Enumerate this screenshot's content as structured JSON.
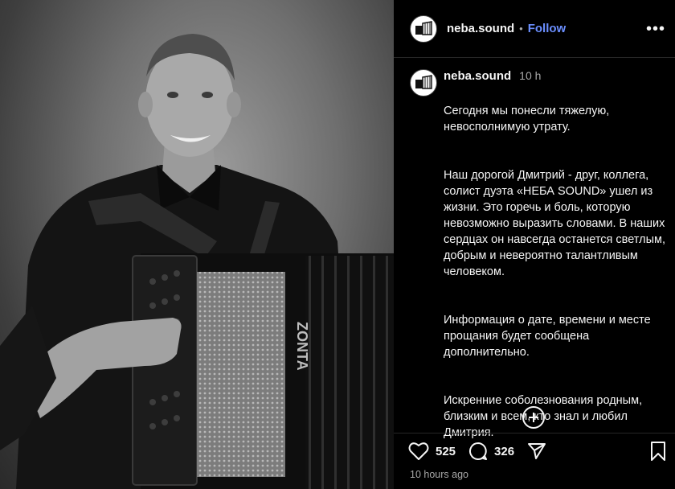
{
  "post": {
    "username": "neba.sound",
    "follow_label": "Follow",
    "separator": "•",
    "more_label": "•••"
  },
  "comment": {
    "username": "neba.sound",
    "time": "10 h",
    "paragraphs": [
      "Сегодня мы понесли тяжелую, невосполнимую утрату.",
      "Наш дорогой Дмитрий -  друг, коллега, солист дуэта «НЕБА SOUND» ушел из жизни. Это горечь и боль, которую невозможно выразить словами. В наших сердцах он навсегда останется светлым, добрым и невероятно талантливым человеком.",
      "Информация о дате, времени и месте прощания будет сообщена дополнительно.",
      "Искренние соболезнования родным, близким и всем, кто знал и любил Дмитрия."
    ]
  },
  "actions": {
    "likes": "525",
    "comments": "326",
    "time_ago": "10 hours ago"
  },
  "icons": {
    "like": "heart-icon",
    "comment": "comment-icon",
    "share": "send-icon",
    "save": "bookmark-icon",
    "add": "plus-circle-icon",
    "more": "more-icon"
  },
  "colors": {
    "follow": "#6b8fff",
    "background": "#000000",
    "muted_text": "#a8a8a8"
  }
}
